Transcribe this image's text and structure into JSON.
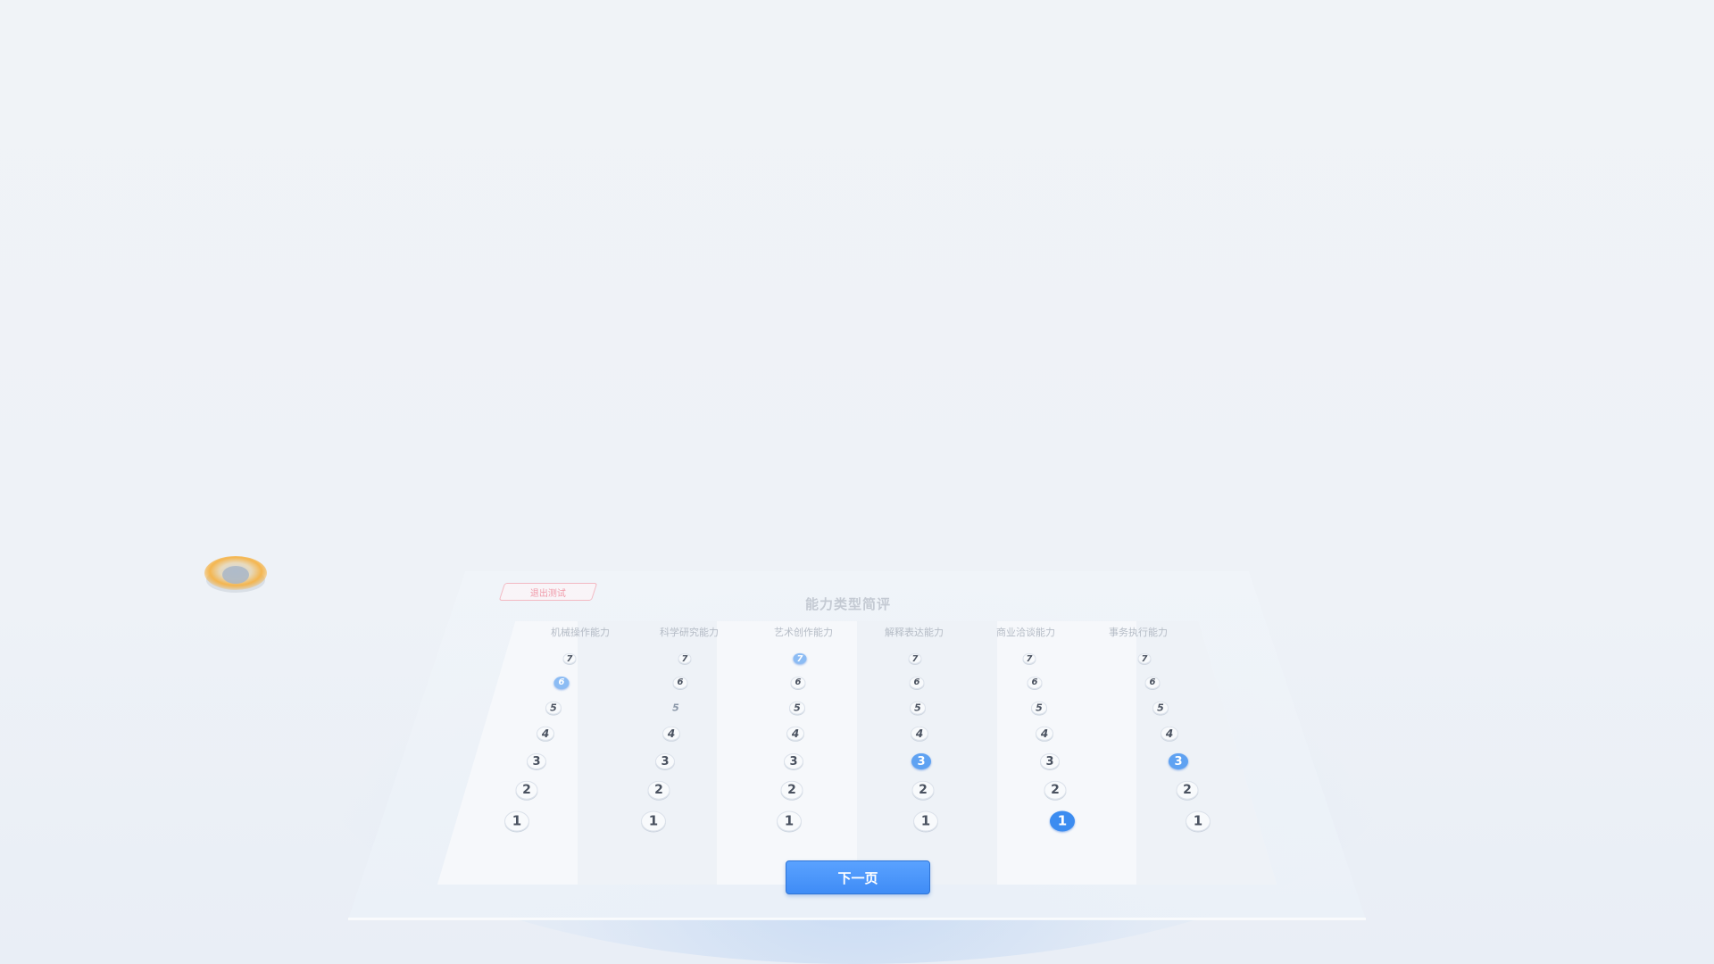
{
  "header": {
    "quit_label": "退出测试",
    "title": "能力类型简评"
  },
  "columns": [
    {
      "label": "机械操作能力",
      "selected": 6
    },
    {
      "label": "科学研究能力",
      "selected": 5
    },
    {
      "label": "艺术创作能力",
      "selected": 7
    },
    {
      "label": "解释表达能力",
      "selected": 3
    },
    {
      "label": "商业洽谈能力",
      "selected": 1
    },
    {
      "label": "事务执行能力",
      "selected": 3
    }
  ],
  "scale": [
    "7",
    "6",
    "5",
    "4",
    "3",
    "2",
    "1"
  ],
  "footer": {
    "next_label": "下一页"
  },
  "colors": {
    "accent": "#3c8cf0",
    "quit_border": "#f3b8c2",
    "hover_ring": "#f5a623"
  }
}
